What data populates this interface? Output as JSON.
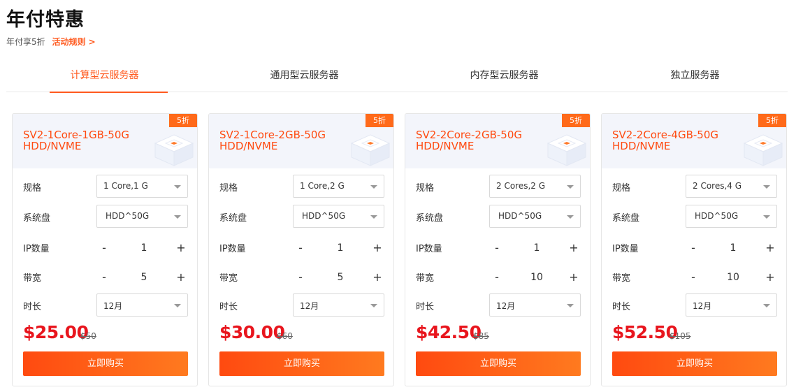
{
  "page": {
    "title": "年付特惠",
    "subtitle": "年付享5折",
    "rules_link": "活动规则 >"
  },
  "tabs": [
    {
      "label": "计算型云服务器",
      "active": true
    },
    {
      "label": "通用型云服务器",
      "active": false
    },
    {
      "label": "内存型云服务器",
      "active": false
    },
    {
      "label": "独立服务器",
      "active": false
    }
  ],
  "labels": {
    "spec": "规格",
    "disk": "系统盘",
    "ip_count": "IP数量",
    "bandwidth": "带宽",
    "duration": "时长",
    "minus": "-",
    "plus": "+",
    "buy": "立即购买"
  },
  "colors": {
    "accent": "#ff5a1f",
    "price": "#e8151d",
    "badge": "#ff6a1a"
  },
  "cards": [
    {
      "badge": "5折",
      "title_line1": "SV2-1Core-1GB-50G",
      "title_line2": "HDD/NVME",
      "spec": "1 Core,1 G",
      "disk": "HDD^50G",
      "ip_count": "1",
      "bandwidth": "5",
      "duration": "12月",
      "price": "$25.00",
      "old_price": "$50"
    },
    {
      "badge": "5折",
      "title_line1": "SV2-1Core-2GB-50G",
      "title_line2": "HDD/NVME",
      "spec": "1 Core,2 G",
      "disk": "HDD^50G",
      "ip_count": "1",
      "bandwidth": "5",
      "duration": "12月",
      "price": "$30.00",
      "old_price": "$60"
    },
    {
      "badge": "5折",
      "title_line1": "SV2-2Core-2GB-50G",
      "title_line2": "HDD/NVME",
      "spec": "2 Cores,2 G",
      "disk": "HDD^50G",
      "ip_count": "1",
      "bandwidth": "10",
      "duration": "12月",
      "price": "$42.50",
      "old_price": "$85"
    },
    {
      "badge": "5折",
      "title_line1": "SV2-2Core-4GB-50G",
      "title_line2": "HDD/NVME",
      "spec": "2 Cores,4 G",
      "disk": "HDD^50G",
      "ip_count": "1",
      "bandwidth": "10",
      "duration": "12月",
      "price": "$52.50",
      "old_price": "$105"
    }
  ]
}
